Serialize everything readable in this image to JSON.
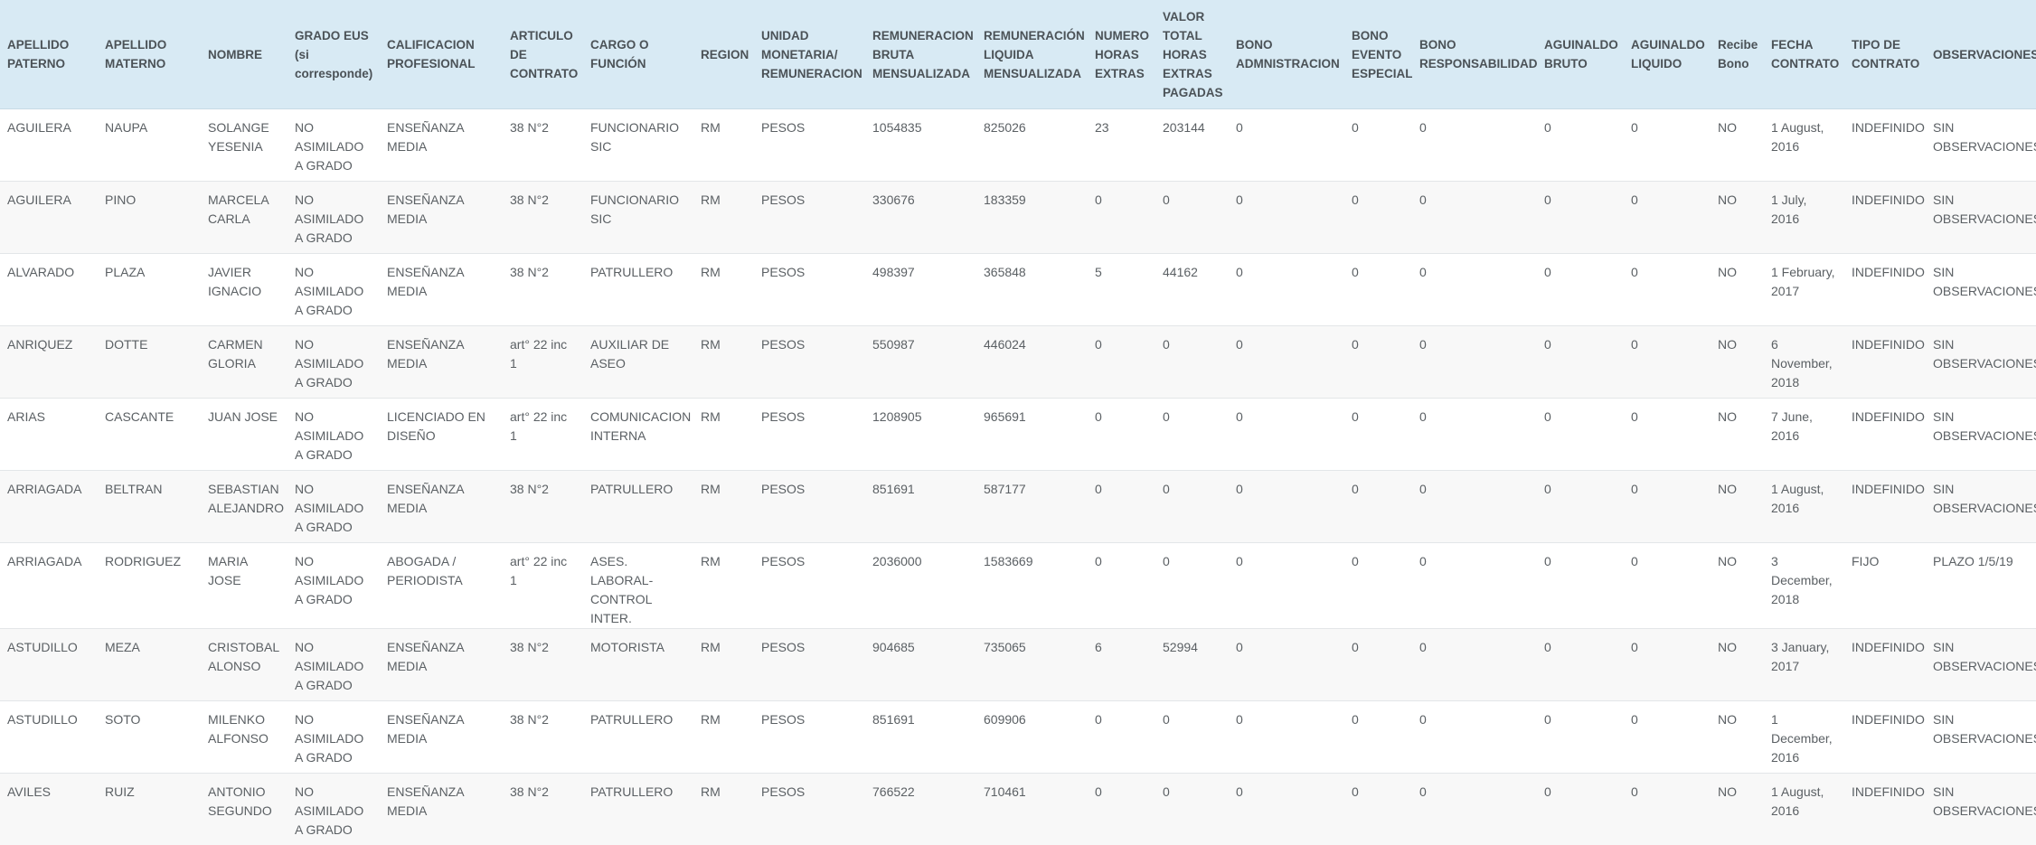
{
  "table": {
    "columns": [
      "APELLIDO PATERNO",
      "APELLIDO MATERNO",
      "NOMBRE",
      "GRADO EUS (si corresponde)",
      "CALIFICACION PROFESIONAL",
      "ARTICULO DE CONTRATO",
      "CARGO O FUNCIÓN",
      "REGION",
      "UNIDAD MONETARIA/ REMUNERACION",
      "REMUNERACION BRUTA MENSUALIZADA",
      "REMUNERACIÓN LIQUIDA MENSUALIZADA",
      "NUMERO HORAS EXTRAS",
      "VALOR TOTAL HORAS EXTRAS PAGADAS",
      "BONO ADMNISTRACION",
      "BONO EVENTO ESPECIAL",
      "BONO RESPONSABILIDAD",
      "AGUINALDO BRUTO",
      "AGUINALDO LIQUIDO",
      "Recibe Bono",
      "FECHA CONTRATO",
      "TIPO DE CONTRATO",
      "OBSERVACIONES"
    ],
    "rows": [
      [
        "AGUILERA",
        "NAUPA",
        "SOLANGE YESENIA",
        "NO ASIMILADO A GRADO",
        "ENSEÑANZA MEDIA",
        "38 N°2",
        "FUNCIONARIO SIC",
        "RM",
        "PESOS",
        "1054835",
        "825026",
        "23",
        "203144",
        "0",
        "0",
        "0",
        "0",
        "0",
        "NO",
        "1 August, 2016",
        "INDEFINIDO",
        "SIN OBSERVACIONES"
      ],
      [
        "AGUILERA",
        "PINO",
        "MARCELA CARLA",
        "NO ASIMILADO A GRADO",
        "ENSEÑANZA MEDIA",
        "38 N°2",
        "FUNCIONARIO SIC",
        "RM",
        "PESOS",
        "330676",
        "183359",
        "0",
        "0",
        "0",
        "0",
        "0",
        "0",
        "0",
        "NO",
        "1 July, 2016",
        "INDEFINIDO",
        "SIN OBSERVACIONES"
      ],
      [
        "ALVARADO",
        "PLAZA",
        "JAVIER IGNACIO",
        "NO ASIMILADO A GRADO",
        "ENSEÑANZA MEDIA",
        "38 N°2",
        "PATRULLERO",
        "RM",
        "PESOS",
        "498397",
        "365848",
        "5",
        "44162",
        "0",
        "0",
        "0",
        "0",
        "0",
        "NO",
        "1 February, 2017",
        "INDEFINIDO",
        "SIN OBSERVACIONES"
      ],
      [
        "ANRIQUEZ",
        "DOTTE",
        "CARMEN GLORIA",
        "NO ASIMILADO A GRADO",
        "ENSEÑANZA MEDIA",
        "art° 22 inc 1",
        "AUXILIAR DE ASEO",
        "RM",
        "PESOS",
        "550987",
        "446024",
        "0",
        "0",
        "0",
        "0",
        "0",
        "0",
        "0",
        "NO",
        "6 November, 2018",
        "INDEFINIDO",
        "SIN OBSERVACIONES"
      ],
      [
        "ARIAS",
        "CASCANTE",
        "JUAN JOSE",
        "NO ASIMILADO A GRADO",
        "LICENCIADO EN DISEÑO",
        "art° 22 inc 1",
        "COMUNICACION INTERNA",
        "RM",
        "PESOS",
        "1208905",
        "965691",
        "0",
        "0",
        "0",
        "0",
        "0",
        "0",
        "0",
        "NO",
        "7 June, 2016",
        "INDEFINIDO",
        "SIN OBSERVACIONES"
      ],
      [
        "ARRIAGADA",
        "BELTRAN",
        "SEBASTIAN ALEJANDRO",
        "NO ASIMILADO A GRADO",
        "ENSEÑANZA MEDIA",
        "38 N°2",
        "PATRULLERO",
        "RM",
        "PESOS",
        "851691",
        "587177",
        "0",
        "0",
        "0",
        "0",
        "0",
        "0",
        "0",
        "NO",
        "1 August, 2016",
        "INDEFINIDO",
        "SIN OBSERVACIONES"
      ],
      [
        "ARRIAGADA",
        "RODRIGUEZ",
        "MARIA JOSE",
        "NO ASIMILADO A GRADO",
        "ABOGADA / PERIODISTA",
        "art° 22 inc 1",
        "ASES. LABORAL-CONTROL INTER.",
        "RM",
        "PESOS",
        "2036000",
        "1583669",
        "0",
        "0",
        "0",
        "0",
        "0",
        "0",
        "0",
        "NO",
        "3 December, 2018",
        "FIJO",
        "PLAZO 1/5/19"
      ],
      [
        "ASTUDILLO",
        "MEZA",
        "CRISTOBAL ALONSO",
        "NO ASIMILADO A GRADO",
        "ENSEÑANZA MEDIA",
        "38 N°2",
        "MOTORISTA",
        "RM",
        "PESOS",
        "904685",
        "735065",
        "6",
        "52994",
        "0",
        "0",
        "0",
        "0",
        "0",
        "NO",
        "3 January, 2017",
        "INDEFINIDO",
        "SIN OBSERVACIONES"
      ],
      [
        "ASTUDILLO",
        "SOTO",
        "MILENKO ALFONSO",
        "NO ASIMILADO A GRADO",
        "ENSEÑANZA MEDIA",
        "38 N°2",
        "PATRULLERO",
        "RM",
        "PESOS",
        "851691",
        "609906",
        "0",
        "0",
        "0",
        "0",
        "0",
        "0",
        "0",
        "NO",
        "1 December, 2016",
        "INDEFINIDO",
        "SIN OBSERVACIONES"
      ],
      [
        "AVILES",
        "RUIZ",
        "ANTONIO SEGUNDO",
        "NO ASIMILADO A GRADO",
        "ENSEÑANZA MEDIA",
        "38 N°2",
        "PATRULLERO",
        "RM",
        "PESOS",
        "766522",
        "710461",
        "0",
        "0",
        "0",
        "0",
        "0",
        "0",
        "0",
        "NO",
        "1 August, 2016",
        "INDEFINIDO",
        "SIN OBSERVACIONES"
      ]
    ]
  }
}
